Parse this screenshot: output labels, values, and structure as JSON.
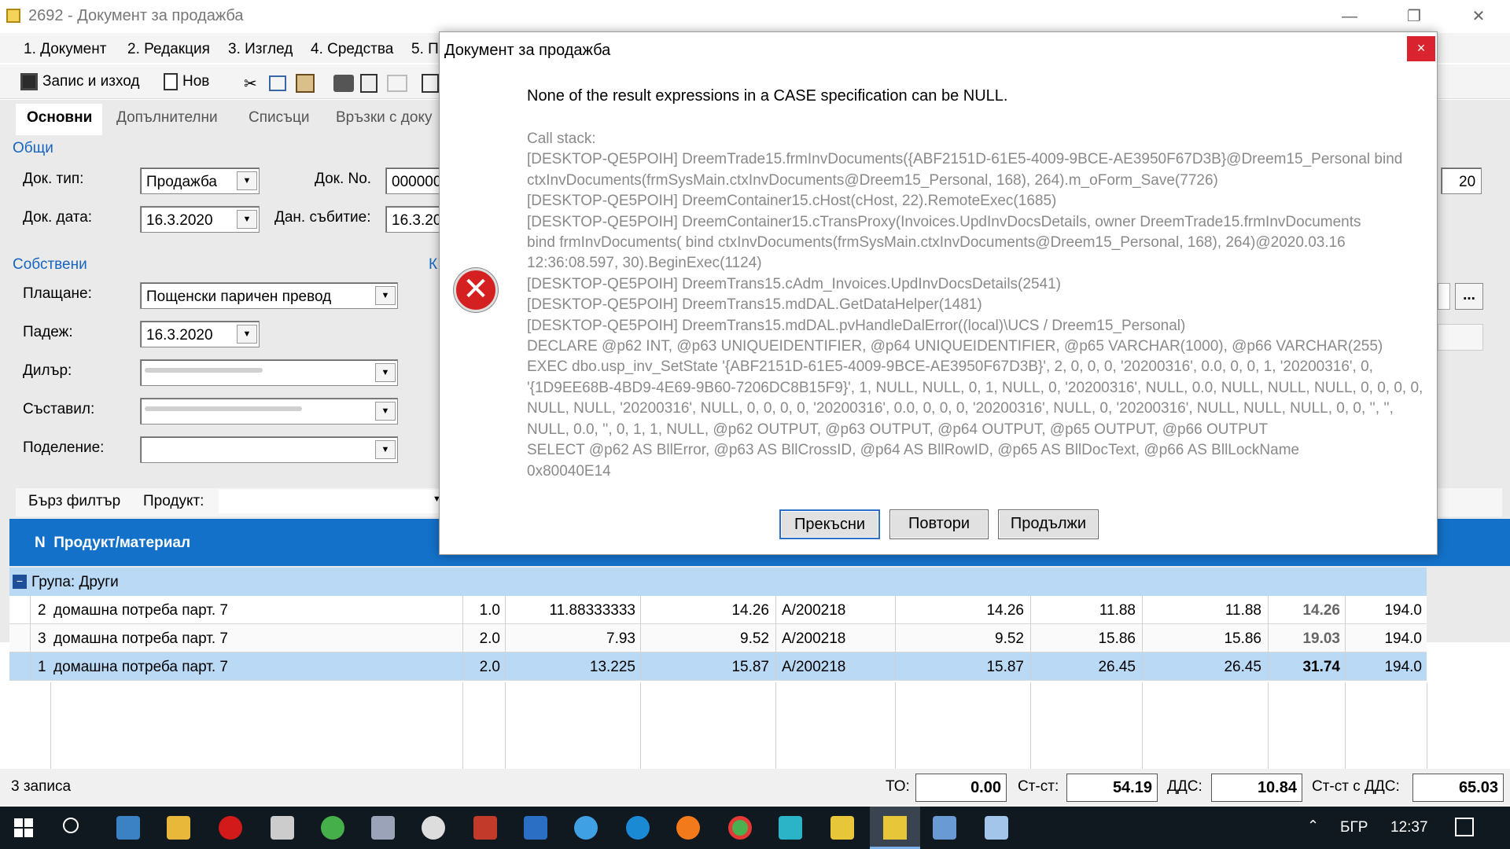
{
  "window": {
    "title": "2692 - Документ за продажба",
    "minimize": "—",
    "restore": "❐",
    "close": "✕"
  },
  "menu": [
    "1. Документ",
    "2. Редакция",
    "3. Изглед",
    "4. Средства",
    "5. П"
  ],
  "toolbar": {
    "save_exit": "Запис и изход",
    "new": "Нов"
  },
  "tabs": [
    "Основни",
    "Допълнителни",
    "Списъци",
    "Връзки с доку"
  ],
  "sections": {
    "general": "Общи",
    "own": "Собствени",
    "k": "К"
  },
  "fields": {
    "doc_type_label": "Док. тип:",
    "doc_type": "Продажба",
    "doc_no_label": "Док. No.",
    "doc_no": "000000",
    "doc_date_label": "Док. дата:",
    "doc_date": "16.3.2020",
    "tax_event_label": "Дан. събитие:",
    "tax_event": "16.3.20",
    "payment_label": "Плащане:",
    "payment": "Пощенски паричен превод",
    "due_label": "Падеж:",
    "due": "16.3.2020",
    "dealer_label": "Дилър:",
    "compiler_label": "Съставил:",
    "division_label": "Поделение:",
    "right_value": "20",
    "browse": "..."
  },
  "filter": {
    "quick_filter": "Бърз филтър",
    "product_label": "Продукт:"
  },
  "grid": {
    "header": "N  Продукт/материал",
    "group": "Група: Други",
    "rows": [
      {
        "n": "2",
        "name": "домашна потреба парт. 7",
        "qty": "1.0",
        "price": "11.88333333",
        "price_vat": "14.26",
        "lot": "A/200218",
        "c1": "14.26",
        "c2": "11.88",
        "c3": "11.88",
        "c4": "14.26",
        "c5": "194.0"
      },
      {
        "n": "3",
        "name": "домашна потреба парт. 7",
        "qty": "2.0",
        "price": "7.93",
        "price_vat": "9.52",
        "lot": "A/200218",
        "c1": "9.52",
        "c2": "15.86",
        "c3": "15.86",
        "c4": "19.03",
        "c5": "194.0"
      },
      {
        "n": "1",
        "name": "домашна потреба парт. 7",
        "qty": "2.0",
        "price": "13.225",
        "price_vat": "15.87",
        "lot": "A/200218",
        "c1": "15.87",
        "c2": "26.45",
        "c3": "26.45",
        "c4": "31.74",
        "c5": "194.0"
      }
    ]
  },
  "footer": {
    "records": "3 записа",
    "to_label": "ТО:",
    "to": "0.00",
    "cost_label": "Ст-ст:",
    "cost": "54.19",
    "vat_label": "ДДС:",
    "vat": "10.84",
    "total_label": "Ст-ст с ДДС:",
    "total": "65.03"
  },
  "dialog": {
    "title": "Документ за продажба",
    "close": "×",
    "message": "None of the result expressions in a CASE specification can be NULL.",
    "stack": [
      "Call stack:",
      "[DESKTOP-QE5POIH] DreemTrade15.frmInvDocuments({ABF2151D-61E5-4009-9BCE-AE3950F67D3B}@Dreem15_Personal bind",
      "ctxInvDocuments(frmSysMain.ctxInvDocuments@Dreem15_Personal, 168), 264).m_oForm_Save(7726)",
      "[DESKTOP-QE5POIH] DreemContainer15.cHost(cHost, 22).RemoteExec(1685)",
      "[DESKTOP-QE5POIH] DreemContainer15.cTransProxy(Invoices.UpdInvDocsDetails, owner DreemTrade15.frmInvDocuments",
      "bind frmInvDocuments( bind ctxInvDocuments(frmSysMain.ctxInvDocuments@Dreem15_Personal, 168), 264)@2020.03.16",
      "12:36:08.597, 30).BeginExec(1124)",
      "[DESKTOP-QE5POIH] DreemTrans15.cAdm_Invoices.UpdInvDocsDetails(2541)",
      "[DESKTOP-QE5POIH] DreemTrans15.mdDAL.GetDataHelper(1481)",
      "[DESKTOP-QE5POIH] DreemTrans15.mdDAL.pvHandleDalError((local)\\UCS / Dreem15_Personal)",
      "DECLARE @p62 INT, @p63 UNIQUEIDENTIFIER, @p64 UNIQUEIDENTIFIER, @p65 VARCHAR(1000), @p66 VARCHAR(255)",
      "EXEC dbo.usp_inv_SetState '{ABF2151D-61E5-4009-9BCE-AE3950F67D3B}', 2, 0, 0, 0, '20200316', 0.0, 0, 0, 1, '20200316', 0,",
      "'{1D9EE68B-4BD9-4E69-9B60-7206DC8B15F9}', 1, NULL, NULL, 0, 1, NULL, 0, '20200316', NULL, 0.0, NULL, NULL, NULL, 0, 0, 0, 0,",
      "NULL, NULL, '20200316', NULL, 0, 0, 0, 0, '20200316', 0.0, 0, 0, 0, '20200316', NULL, 0, '20200316', NULL, NULL, NULL, 0, 0, '', '',",
      "NULL, 0.0, '', 0, 1, 1, NULL, @p62 OUTPUT, @p63 OUTPUT, @p64 OUTPUT, @p65 OUTPUT, @p66 OUTPUT",
      "SELECT @p62 AS BllError, @p63 AS BllCrossID, @p64 AS BllRowID, @p65 AS BllDocText, @p66 AS BllLockName",
      "0x80040E14"
    ],
    "buttons": {
      "abort": "Прекъсни",
      "retry": "Повтори",
      "continue": "Продължи"
    }
  },
  "taskbar": {
    "lang": "БГР",
    "time": "12:37"
  }
}
